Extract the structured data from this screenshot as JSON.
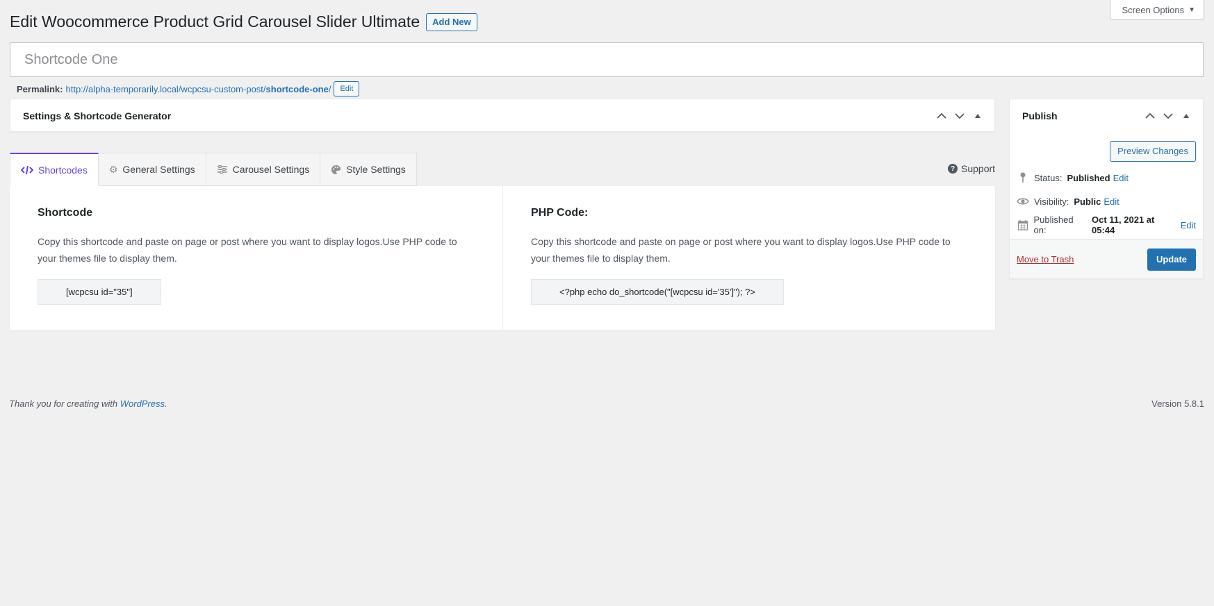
{
  "screen_options": {
    "label": "Screen Options"
  },
  "header": {
    "title": "Edit Woocommerce Product Grid Carousel Slider Ultimate",
    "add_new": "Add New"
  },
  "post_title": {
    "value": "Shortcode One"
  },
  "permalink": {
    "label": "Permalink:",
    "url_base": "http://alpha-temporarily.local/wcpcsu-custom-post/",
    "slug": "shortcode-one",
    "trailing": "/",
    "edit_label": "Edit"
  },
  "settings_box": {
    "title": "Settings & Shortcode Generator"
  },
  "tabs": [
    {
      "label": "Shortcodes",
      "icon": "code-icon",
      "active": true
    },
    {
      "label": "General Settings",
      "icon": "gear-icon",
      "active": false
    },
    {
      "label": "Carousel Settings",
      "icon": "sliders-icon",
      "active": false
    },
    {
      "label": "Style Settings",
      "icon": "palette-icon",
      "active": false
    }
  ],
  "support": {
    "label": "Support"
  },
  "shortcode_section": {
    "title": "Shortcode",
    "description": "Copy this shortcode and paste on page or post where you want to display logos.Use PHP code to your themes file to display them.",
    "code": "[wcpcsu id=\"35\"]"
  },
  "php_section": {
    "title": "PHP Code:",
    "description": "Copy this shortcode and paste on page or post where you want to display logos.Use PHP code to your themes file to display them.",
    "code": "<?php echo do_shortcode(\"[wcpcsu id='35']\"); ?>"
  },
  "publish": {
    "title": "Publish",
    "preview": "Preview Changes",
    "status_label": "Status:",
    "status_value": "Published",
    "visibility_label": "Visibility:",
    "visibility_value": "Public",
    "published_label": "Published on:",
    "published_value": "Oct 11, 2021 at 05:44",
    "edit": "Edit",
    "trash": "Move to Trash",
    "update": "Update"
  },
  "footer": {
    "thanks_prefix": "Thank you for creating with ",
    "wordpress": "WordPress",
    "thanks_suffix": ".",
    "version": "Version 5.8.1"
  },
  "colors": {
    "accent": "#6b40e0",
    "wp_blue": "#2271b1",
    "trash_red": "#b32d2e"
  }
}
